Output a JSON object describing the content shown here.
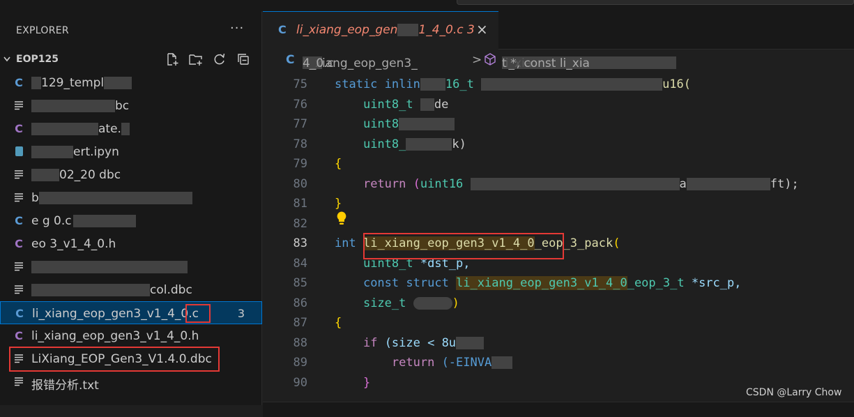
{
  "sidebar": {
    "title": "EXPLORER",
    "more_label": "···",
    "section_title": "EOP125",
    "action_icons": [
      "new-file-icon",
      "new-folder-icon",
      "refresh-icon",
      "collapse-all-icon"
    ],
    "files": [
      {
        "icon": "c",
        "label": "129_templ"
      },
      {
        "icon": "txt",
        "label": "bc"
      },
      {
        "icon": "c",
        "label": "ate."
      },
      {
        "icon": "ipynb",
        "label": "ert.ipyn"
      },
      {
        "icon": "txt",
        "label": "02_20 dbc"
      },
      {
        "icon": "txt",
        "label": "b"
      },
      {
        "icon": "c",
        "label": "e g 0.c"
      },
      {
        "icon": "c",
        "label": "eo 3_v1_4_0.h"
      },
      {
        "icon": "txt",
        "label": ""
      },
      {
        "icon": "txt",
        "label": "col.dbc"
      },
      {
        "icon": "c",
        "label": "li_xiang_eop_gen3_v1_4_0.c",
        "badge": "3",
        "selected": true
      },
      {
        "icon": "h",
        "label": "li_xiang_eop_gen3_v1_4_0.h"
      },
      {
        "icon": "txt",
        "label": "LiXiang_EOP_Gen3_V1.4.0.dbc"
      },
      {
        "icon": "txt",
        "label": "报错分析.txt"
      }
    ]
  },
  "editor": {
    "tab": {
      "icon": "C",
      "label": "li_xiang_eop_gen",
      "label_tail": "1_4_0.c",
      "problems": "3",
      "close": "×"
    },
    "breadcrumb": {
      "file_icon": "C",
      "file": "li_xiang_eop_gen3_",
      "file_tail": "4_0.c",
      "sep": ">",
      "symbol": "li_xia",
      "symbol_tail": "t *, const li_xia"
    },
    "lines": [
      {
        "n": "75"
      },
      {
        "n": "76"
      },
      {
        "n": "77"
      },
      {
        "n": "78"
      },
      {
        "n": "79"
      },
      {
        "n": "80"
      },
      {
        "n": "81"
      },
      {
        "n": "82"
      },
      {
        "n": "83"
      },
      {
        "n": "84"
      },
      {
        "n": "85"
      },
      {
        "n": "86"
      },
      {
        "n": "87"
      },
      {
        "n": "88"
      },
      {
        "n": "89"
      },
      {
        "n": "90"
      }
    ],
    "code": {
      "l75_kw": "static",
      "l75_inline": "inlin",
      "l75_ty": "16_t",
      "l75_tail": "u16(",
      "l76": "uint8_t",
      "l76_tail": "de",
      "l77": "uint8",
      "l77_tail": "",
      "l78": "uint8_",
      "l78_tail": "k)",
      "l79": "{",
      "l80_ret": "return",
      "l80_paren": "(",
      "l80_ty": "uint16",
      "l80_mid": "a",
      "l80_tail": "ft);",
      "l81": "}",
      "l83_int": "int",
      "l83_fn": "li_xiang_eop_gen3_v1_4_0",
      "l83_fn_tail": "_eop_3_pack",
      "l83_paren": "(",
      "l84_ty": "uint8_t",
      "l84_rest": " *dst_p,",
      "l85_kw": "const",
      "l85_kw2": "struct",
      "l85_ty": "li_xiang_eop_gen3_v1_4_0",
      "l85_ty_tail": "_eop_3_t",
      "l85_rest": " *src_p,",
      "l86_ty": "size_t",
      "l86_tail": ")",
      "l87": "{",
      "l88_kw": "if",
      "l88_rest": "(size < 8u",
      "l89_kw": "return",
      "l89_rest": "(-EINVA",
      "l90": "}"
    }
  },
  "watermark": "CSDN @Larry Chow"
}
